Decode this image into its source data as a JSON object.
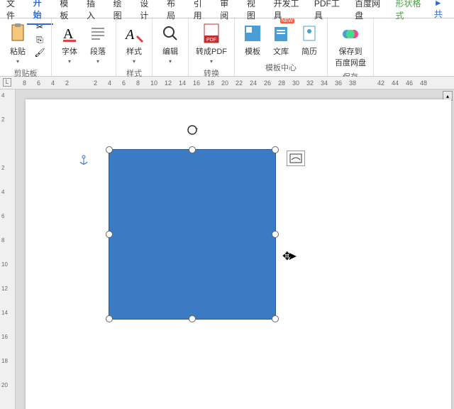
{
  "menu": {
    "items": [
      "文件",
      "开始",
      "模板",
      "插入",
      "绘图",
      "设计",
      "布局",
      "引用",
      "审阅",
      "视图",
      "开发工具",
      "PDF工具",
      "百度网盘"
    ],
    "active_index": 1,
    "context_tab": "形状格式",
    "share": "共"
  },
  "ribbon": {
    "groups": [
      {
        "label": "剪贴板",
        "buttons": [
          {
            "label": "粘贴",
            "icon": "paste"
          }
        ]
      },
      {
        "label": "",
        "buttons": [
          {
            "label": "字体",
            "icon": "font"
          },
          {
            "label": "段落",
            "icon": "para"
          }
        ]
      },
      {
        "label": "样式",
        "buttons": [
          {
            "label": "样式",
            "icon": "style"
          }
        ]
      },
      {
        "label": "",
        "buttons": [
          {
            "label": "编辑",
            "icon": "find"
          }
        ]
      },
      {
        "label": "转换",
        "buttons": [
          {
            "label": "转成PDF",
            "icon": "pdf"
          }
        ]
      },
      {
        "label": "模板中心",
        "buttons": [
          {
            "label": "模板",
            "icon": "tmpl"
          },
          {
            "label": "文库",
            "icon": "lib",
            "badge": "NEW"
          },
          {
            "label": "简历",
            "icon": "resume"
          }
        ]
      },
      {
        "label": "保存",
        "buttons": [
          {
            "label": "保存到\n百度网盘",
            "icon": "cloud"
          }
        ]
      }
    ]
  },
  "ruler_h": [
    "8",
    "6",
    "4",
    "2",
    "",
    "2",
    "4",
    "6",
    "8",
    "10",
    "12",
    "14",
    "16",
    "18",
    "20",
    "22",
    "24",
    "26",
    "28",
    "30",
    "32",
    "34",
    "36",
    "38",
    "",
    "42",
    "44",
    "46",
    "48"
  ],
  "ruler_v": [
    "4",
    "2",
    "",
    "2",
    "4",
    "6",
    "8",
    "10",
    "12",
    "14",
    "16",
    "18",
    "20"
  ],
  "shape": {
    "type": "rectangle"
  }
}
